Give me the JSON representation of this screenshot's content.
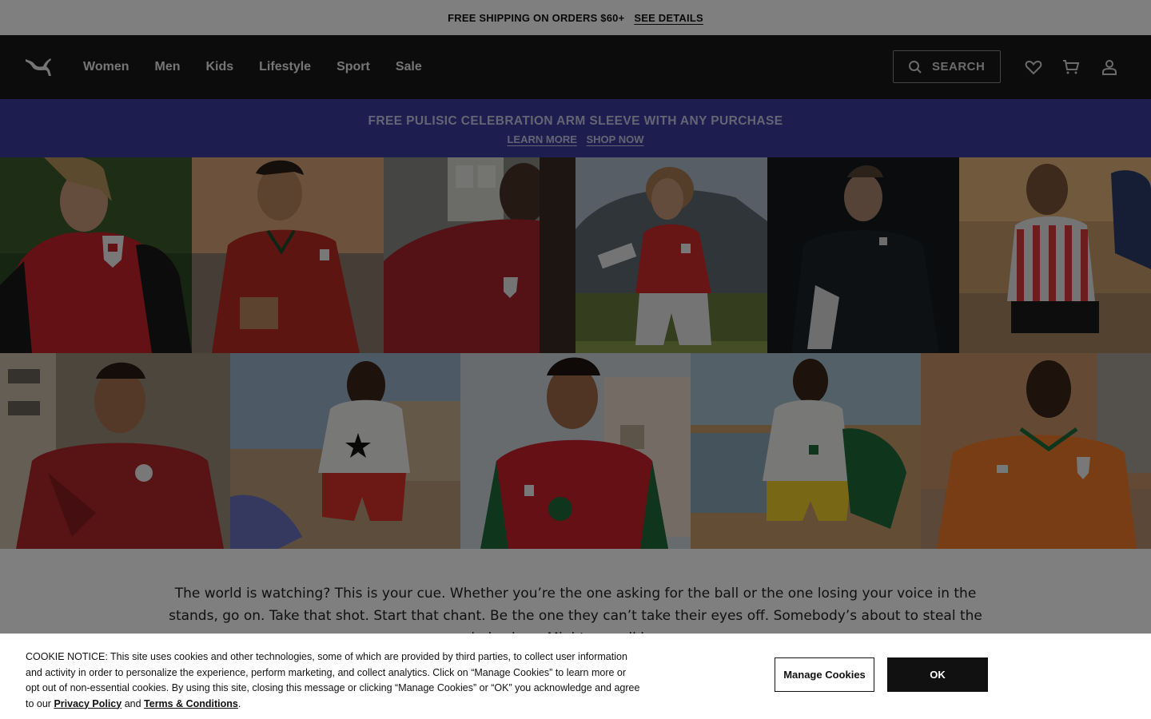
{
  "promo": {
    "text": "FREE SHIPPING ON ORDERS $60+",
    "link": "SEE DETAILS"
  },
  "header": {
    "logo": "puma-cat-logo",
    "nav": [
      "Women",
      "Men",
      "Kids",
      "Lifestyle",
      "Sport",
      "Sale"
    ],
    "search_label": "SEARCH",
    "icons": [
      "search-icon",
      "heart-icon",
      "cart-icon",
      "account-icon"
    ]
  },
  "banner": {
    "title": "FREE PULISIC CELEBRATION ARM SLEEVE WITH ANY PURCHASE",
    "learn_more": "LEARN MORE",
    "shop_now": "SHOP NOW",
    "color": "#3a3b9f"
  },
  "gallery": {
    "row1": [
      "austria-red-kit",
      "portugal-red-kit",
      "czech-red-kit",
      "switzerland-red-kit",
      "new-zealand-black-kit",
      "paraguay-striped-kit"
    ],
    "row2": [
      "egypt-red-kit",
      "ghana-white-kit",
      "morocco-red-kit",
      "senegal-white-kit",
      "ivory-coast-orange-kit"
    ]
  },
  "body_copy": "The world is watching? This is your cue. Whether you’re the one asking for the ball or the one losing your voice in the stands, go on. Take that shot. Start that chant. Be the one they can’t take their eyes off. Somebody’s about to steal the whole show. Might as well be you.",
  "cookie": {
    "text_before": "COOKIE NOTICE: This site uses cookies and other technologies, some of which are provided by third parties, to collect user information and activity in order to personalize the experience, perform marketing, and collect analytics. Click on “Manage Cookies” to learn more or opt out of non-essential cookies. By using this site, closing this message or clicking “Manage Cookies” or “OK” you acknowledge and agree to our ",
    "privacy": "Privacy Policy",
    "and": " and ",
    "terms": "Terms & Conditions",
    "end": ".",
    "manage_label": "Manage Cookies",
    "ok_label": "OK"
  }
}
